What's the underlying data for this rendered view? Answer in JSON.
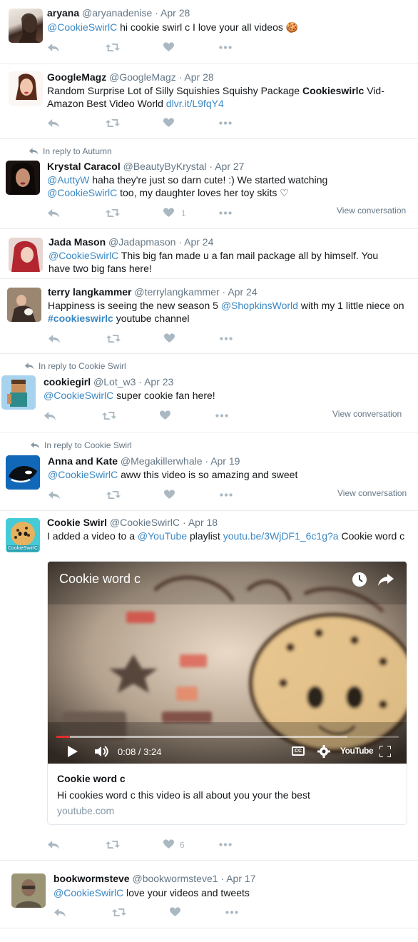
{
  "tweets": [
    {
      "name": "aryana",
      "handle": "@aryanadenise",
      "sep": "·",
      "date": "Apr 28",
      "body": {
        "m1": "@CookieSwirlC",
        "t1": " hi cookie swirl c I love your all videos 🍪"
      }
    },
    {
      "name": "GoogleMagz",
      "handle": "@GoogleMagz",
      "sep": "·",
      "date": "Apr 28",
      "body": {
        "t1": "Random Surprise Lot of Silly Squishies Squishy Package ",
        "b1": "Cookieswirlc",
        "t2": " Vid- Amazon Best Video World ",
        "l1": "dlvr.it/L9fqY4"
      }
    },
    {
      "reply_to": "In reply to Autumn",
      "name": "Krystal Caracol",
      "handle": "@BeautyByKrystal",
      "sep": "·",
      "date": "Apr 27",
      "body": {
        "m1": "@AuttyW",
        "t1": " haha they're just so darn cute! :) We started watching ",
        "m2": "@CookieSwirlC",
        "t2": " too, my daughter loves her toy skits ♡"
      },
      "likes": "1",
      "view_conversation": "View conversation"
    },
    {
      "name": "Jada Mason",
      "handle": "@Jadapmason",
      "sep": "·",
      "date": "Apr 24",
      "body": {
        "m1": "@CookieSwirlC",
        "t1": " This big fan made u a fan mail package all by himself.  You have two big fans here!"
      }
    },
    {
      "name": "terry langkammer",
      "handle": "@terrylangkammer",
      "sep": "·",
      "date": "Apr 24",
      "body": {
        "t1": "Happiness is seeing the new season 5 ",
        "m1": "@ShopkinsWorld",
        "t2": " with my 1 little niece on ",
        "h1": "#cookieswirlc",
        "t3": " youtube channel"
      }
    },
    {
      "reply_to": "In reply to Cookie Swirl",
      "name": "cookiegirl",
      "handle": "@Lot_w3",
      "sep": "·",
      "date": "Apr 23",
      "body": {
        "m1": "@CookieSwirlC",
        "t1": " super cookie fan here!"
      },
      "view_conversation": "View conversation"
    },
    {
      "reply_to": "In reply to Cookie Swirl",
      "name": "Anna and Kate",
      "handle": "@Megakillerwhale",
      "sep": "·",
      "date": "Apr 19",
      "body": {
        "m1": "@CookieSwirlC",
        "t1": " aww this video is so amazing and sweet"
      },
      "view_conversation": "View conversation"
    },
    {
      "name": "Cookie Swirl",
      "handle": "@CookieSwirlC",
      "sep": "·",
      "date": "Apr 18",
      "body": {
        "t1": "I added a video to a ",
        "m1": "@YouTube",
        "t2": " playlist ",
        "l1": "youtu.be/3WjDF1_6c1g?a",
        "t3": " Cookie word c"
      },
      "avatar_text": "CookieSwirlC",
      "likes": "6",
      "card": {
        "video_title": "Cookie word c",
        "time_current": "0:08",
        "time_sep": " / ",
        "time_total": "3:24",
        "progress": 0.04,
        "buffered": 0.85,
        "youtube_logo": "YouTube",
        "cc_label": "CC",
        "title": "Cookie word c",
        "description": "Hi cookies word c this video is all about you your the best",
        "domain": "youtube.com"
      }
    },
    {
      "name": "bookwormsteve",
      "handle": "@bookwormsteve1",
      "sep": "·",
      "date": "Apr 17",
      "body": {
        "m1": "@CookieSwirlC",
        "t1": " love your videos and tweets"
      }
    }
  ],
  "colors": {
    "link": "#3b88c3",
    "icon": "#aab8c2",
    "muted": "#657786",
    "divider": "#e6ecf0"
  },
  "icons": [
    "reply-icon",
    "retweet-icon",
    "heart-icon",
    "more-icon",
    "clock-icon",
    "share-icon",
    "play-icon",
    "volume-icon",
    "cc-icon",
    "settings-icon",
    "fullscreen-icon"
  ]
}
